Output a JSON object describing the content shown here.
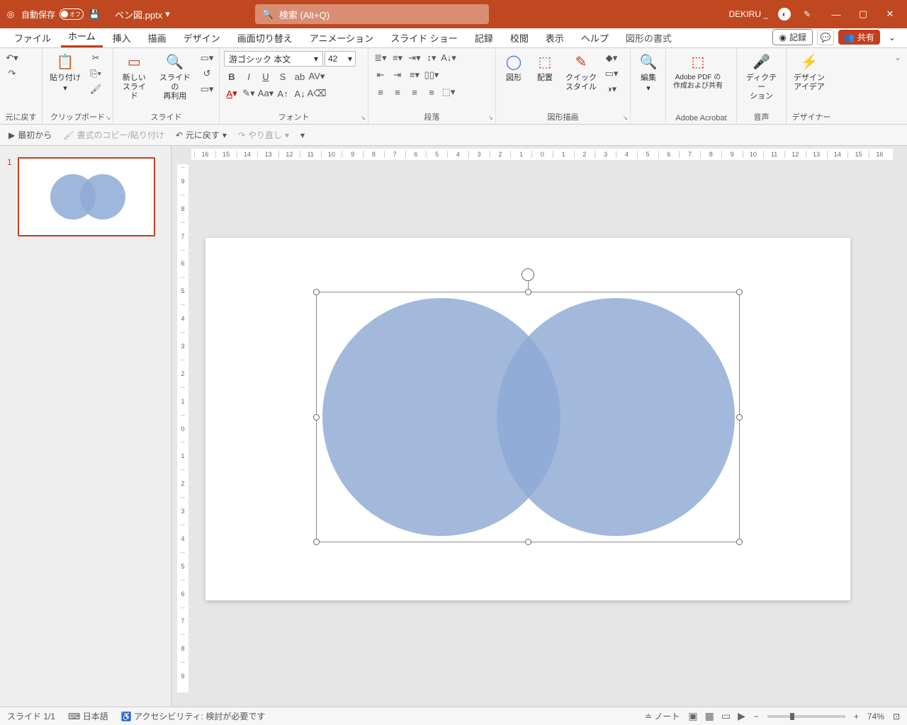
{
  "title": {
    "autosave_label": "自動保存",
    "autosave_state": "オフ",
    "filename": "ベン図.pptx",
    "search_placeholder": "検索 (Alt+Q)",
    "user": "DEKIRU _"
  },
  "tabs": {
    "file": "ファイル",
    "home": "ホーム",
    "insert": "挿入",
    "draw": "描画",
    "design": "デザイン",
    "transitions": "画面切り替え",
    "animations": "アニメーション",
    "slideshow": "スライド ショー",
    "record_tab": "記録",
    "review": "校閲",
    "view": "表示",
    "help": "ヘルプ",
    "shape_format": "図形の書式",
    "record_chip": "記録",
    "share": "共有"
  },
  "ribbon": {
    "undo_group": "元に戻す",
    "clipboard_group": "クリップボード",
    "paste": "貼り付け",
    "slides_group": "スライド",
    "new_slide": "新しい\nスライド",
    "reuse_slide": "スライドの\n再利用",
    "font_group": "フォント",
    "font_name": "游ゴシック 本文",
    "font_size": "42",
    "paragraph_group": "段落",
    "drawing_group": "図形描画",
    "shapes": "図形",
    "arrange": "配置",
    "quickstyle": "クイック\nスタイル",
    "editing": "編集",
    "acrobat_group": "Adobe Acrobat",
    "acrobat": "Adobe PDF の\n作成および共有",
    "voice_group": "音声",
    "dictate": "ディクテー\nション",
    "designer_group": "デザイナー",
    "design_ideas": "デザイン\nアイデア"
  },
  "sectoolbar": {
    "from_start": "最初から",
    "format_painter": "書式のコピー/貼り付け",
    "undo": "元に戻す",
    "redo": "やり直し"
  },
  "panel": {
    "slide_num": "1"
  },
  "status": {
    "slide": "スライド 1/1",
    "lang": "日本語",
    "a11y": "アクセシビリティ: 検討が必要です",
    "notes": "ノート",
    "zoom": "74%"
  },
  "ruler_h": [
    "16",
    "15",
    "14",
    "13",
    "12",
    "11",
    "10",
    "9",
    "8",
    "7",
    "6",
    "5",
    "4",
    "3",
    "2",
    "1",
    "0",
    "1",
    "2",
    "3",
    "4",
    "5",
    "6",
    "7",
    "8",
    "9",
    "10",
    "11",
    "12",
    "13",
    "14",
    "15",
    "16"
  ],
  "ruler_v": [
    "9",
    "8",
    "7",
    "6",
    "5",
    "4",
    "3",
    "2",
    "1",
    "0",
    "1",
    "2",
    "3",
    "4",
    "5",
    "6",
    "7",
    "8",
    "9"
  ]
}
